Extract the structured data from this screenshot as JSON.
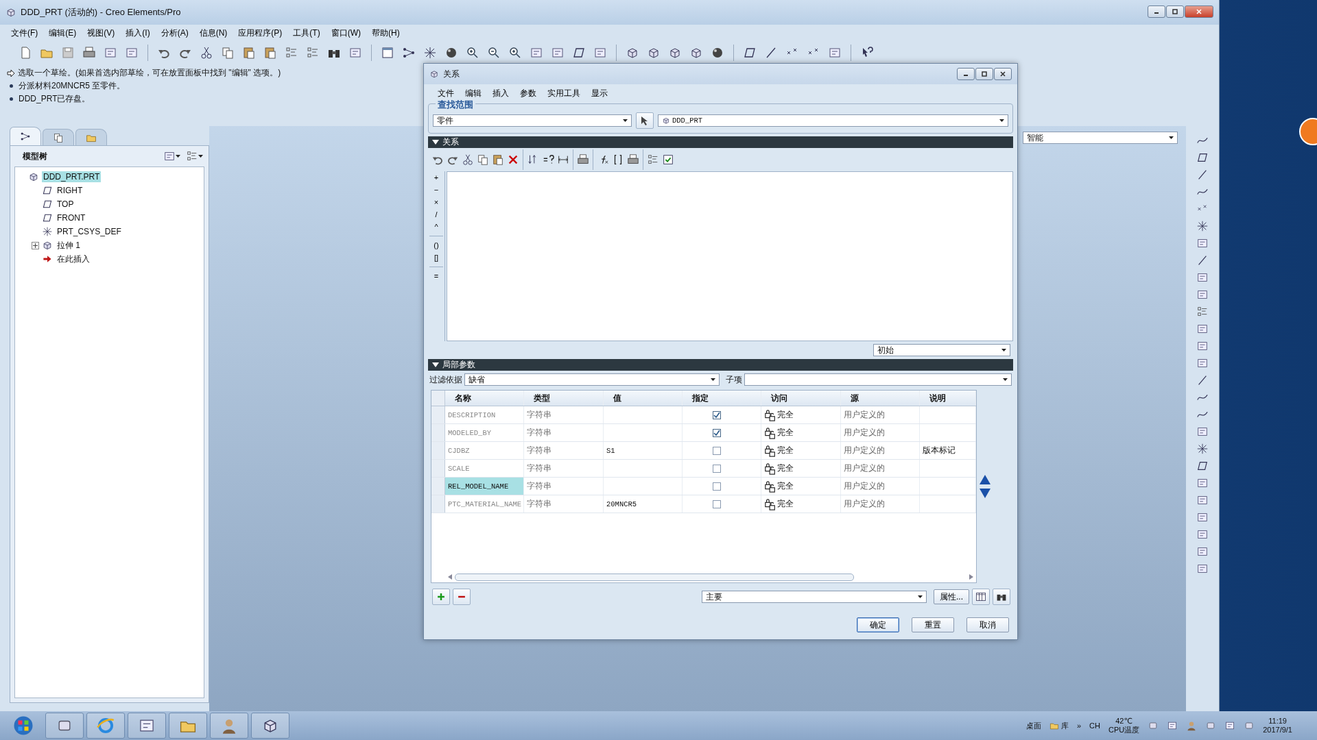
{
  "window": {
    "title": "DDD_PRT (活动的) - Creo Elements/Pro",
    "menus": [
      "文件(F)",
      "编辑(E)",
      "视图(V)",
      "插入(I)",
      "分析(A)",
      "信息(N)",
      "应用程序(P)",
      "工具(T)",
      "窗口(W)",
      "帮助(H)"
    ]
  },
  "messages": [
    {
      "kind": "prompt",
      "text": "选取一个草绘。(如果首选内部草绘，可在放置面板中找到 \"编辑\" 选项。)"
    },
    {
      "kind": "info",
      "text": "分派材料20MNCR5 至零件。"
    },
    {
      "kind": "info",
      "text": "DDD_PRT已存盘。"
    }
  ],
  "model_tree": {
    "tabs": [
      {
        "kind": "tree",
        "selected": true
      },
      {
        "kind": "layers",
        "selected": false
      },
      {
        "kind": "folder",
        "selected": false
      }
    ],
    "title": "模型树",
    "items": [
      {
        "kind": "part",
        "label": "DDD_PRT.PRT",
        "selected": true,
        "children": [
          {
            "kind": "plane",
            "label": "RIGHT",
            "selected": false
          },
          {
            "kind": "plane",
            "label": "TOP",
            "selected": false
          },
          {
            "kind": "plane",
            "label": "FRONT",
            "selected": false
          },
          {
            "kind": "csys",
            "label": "PRT_CSYS_DEF",
            "selected": false
          },
          {
            "kind": "feature",
            "label": "拉伸 1",
            "selected": false,
            "expanded": false
          },
          {
            "kind": "insert",
            "label": "在此插入",
            "selected": false
          }
        ]
      }
    ]
  },
  "graphics": {
    "selection_filter": "智能"
  },
  "dialog": {
    "title": "关系",
    "menus": [
      "文件",
      "编辑",
      "插入",
      "参数",
      "实用工具",
      "显示"
    ],
    "scope": {
      "label": "查找范围",
      "type": "零件",
      "model": "DDD_PRT"
    },
    "relations": {
      "header": "关系",
      "operators": [
        "+",
        "−",
        "×",
        "/",
        "^",
        "()",
        "[]",
        "="
      ],
      "mode": "初始"
    },
    "parameters": {
      "header": "局部参数",
      "filter_label": "过滤依据",
      "filter": "缺省",
      "sub_label": "子项",
      "columns": [
        "名称",
        "类型",
        "值",
        "指定",
        "访问",
        "源",
        "说明"
      ],
      "rows": [
        {
          "name": "DESCRIPTION",
          "type": "字符串",
          "designated": true,
          "access": "完全",
          "source": "用户定义的",
          "selected": false
        },
        {
          "name": "MODELED_BY",
          "type": "字符串",
          "designated": true,
          "access": "完全",
          "source": "用户定义的",
          "selected": false
        },
        {
          "name": "CJDBZ",
          "type": "字符串",
          "value": "S1",
          "designated": false,
          "access": "完全",
          "source": "用户定义的",
          "description": "版本标记",
          "selected": false
        },
        {
          "name": "SCALE",
          "type": "字符串",
          "designated": false,
          "access": "完全",
          "source": "用户定义的",
          "selected": false
        },
        {
          "name": "REL_MODEL_NAME",
          "type": "字符串",
          "designated": false,
          "access": "完全",
          "source": "用户定义的",
          "selected": true
        },
        {
          "name": "PTC_MATERIAL_NAME",
          "type": "字符串",
          "value": "20MNCR5",
          "designated": false,
          "access": "完全",
          "source": "用户定义的",
          "selected": false
        }
      ],
      "scope": "主要",
      "properties_button": "属性..."
    },
    "buttons": [
      {
        "label": "确定",
        "default": true
      },
      {
        "label": "重置",
        "default": false
      },
      {
        "label": "取消",
        "default": false
      }
    ]
  },
  "taskbar": {
    "toolbars": [
      "桌面",
      "库"
    ],
    "more": "»",
    "language": "CH",
    "temperature": "42℃",
    "temperature_label": "CPU温度",
    "time": "11:19",
    "date": "2017/9/1"
  }
}
